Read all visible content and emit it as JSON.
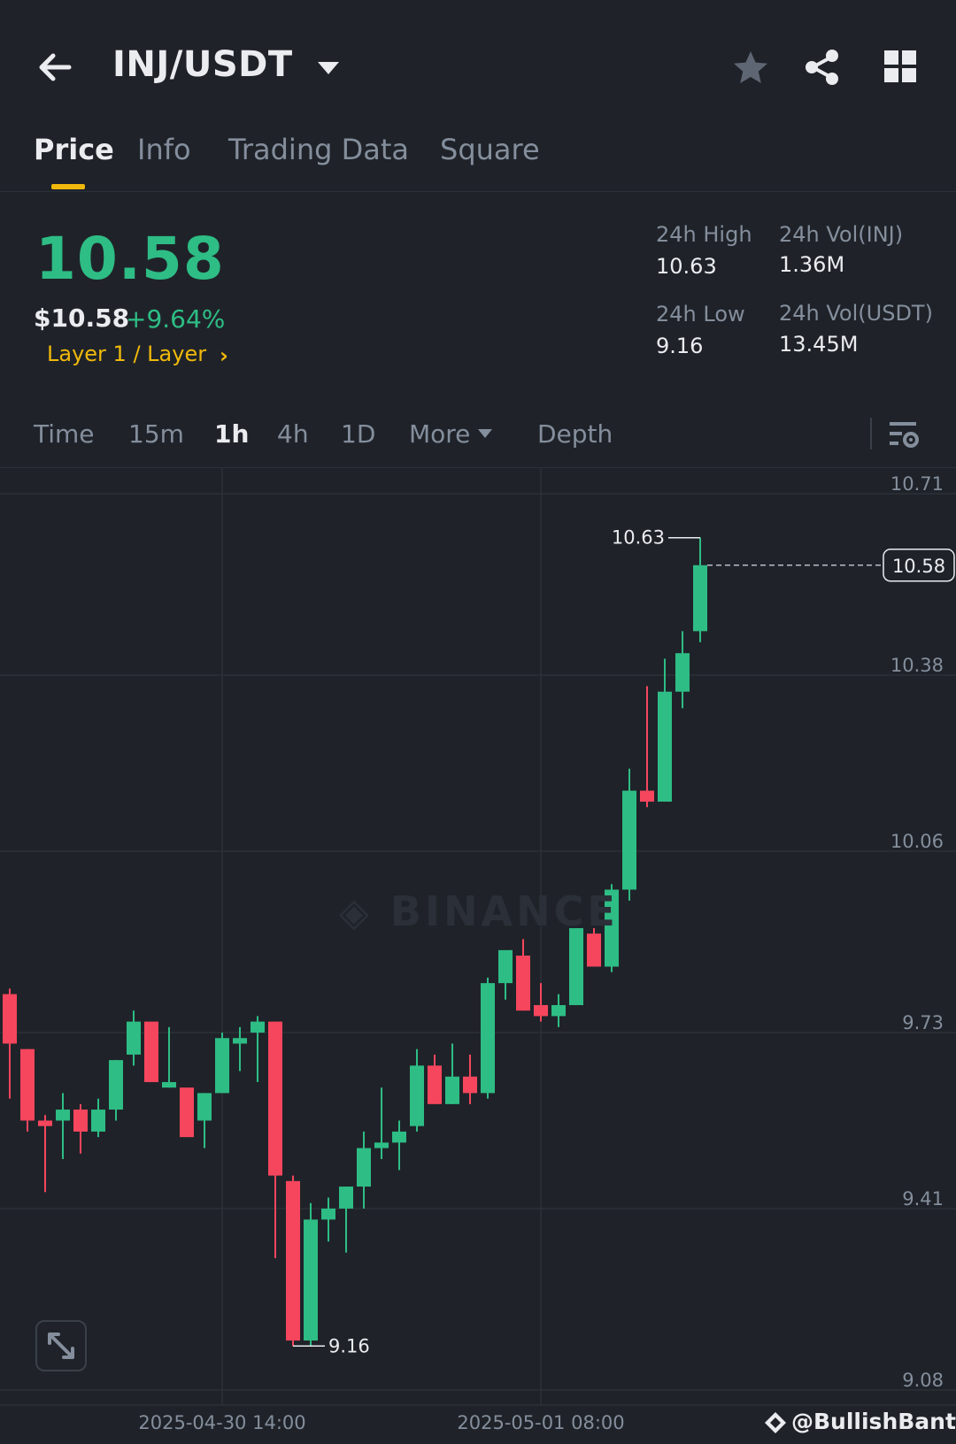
{
  "header": {
    "pair": "INJ/USDT",
    "icons": [
      "back-arrow-icon",
      "caret-down-icon",
      "star-icon",
      "share-icon",
      "grid-icon"
    ]
  },
  "tabs": [
    {
      "label": "Price",
      "active": true
    },
    {
      "label": "Info",
      "active": false
    },
    {
      "label": "Trading Data",
      "active": false
    },
    {
      "label": "Square",
      "active": false
    }
  ],
  "ticker": {
    "last_price": "10.58",
    "usd_price": "$10.58",
    "change": "+9.64%",
    "tag": "Layer 1 / Layer",
    "tag_arrow": "›"
  },
  "stats": {
    "high_label": "24h High",
    "high_value": "10.63",
    "low_label": "24h Low",
    "low_value": "9.16",
    "vol_inj_label": "24h Vol(INJ)",
    "vol_inj_value": "1.36M",
    "vol_usdt_label": "24h Vol(USDT)",
    "vol_usdt_value": "13.45M"
  },
  "intervals": [
    {
      "label": "Time",
      "active": false
    },
    {
      "label": "15m",
      "active": false
    },
    {
      "label": "1h",
      "active": true
    },
    {
      "label": "4h",
      "active": false
    },
    {
      "label": "1D",
      "active": false
    },
    {
      "label": "More",
      "active": false,
      "dropdown": true
    },
    {
      "label": "Depth",
      "active": false
    }
  ],
  "colors": {
    "up": "#2ebd85",
    "down": "#f6465d",
    "accent": "#f0b90b",
    "background": "#1f2329",
    "grid": "#2b3139"
  },
  "watermark": "BINANCE",
  "handle": "@BullishBanter",
  "chart_data": {
    "type": "candlestick",
    "interval": "1h",
    "y_ticks": [
      "10.71",
      "10.38",
      "10.06",
      "9.73",
      "9.41",
      "9.08"
    ],
    "ylim": [
      9.08,
      10.71
    ],
    "x_ticks": [
      "2025-04-30 14:00",
      "2025-05-01 08:00"
    ],
    "x_tick_index": [
      12,
      30
    ],
    "last_price_label": "10.58",
    "high_annotation": "10.63",
    "low_annotation": "9.16",
    "candles": [
      {
        "o": 9.8,
        "h": 9.81,
        "l": 9.61,
        "c": 9.71
      },
      {
        "o": 9.7,
        "h": 9.7,
        "l": 9.55,
        "c": 9.57
      },
      {
        "o": 9.57,
        "h": 9.58,
        "l": 9.44,
        "c": 9.56
      },
      {
        "o": 9.57,
        "h": 9.62,
        "l": 9.5,
        "c": 9.59
      },
      {
        "o": 9.59,
        "h": 9.6,
        "l": 9.51,
        "c": 9.55
      },
      {
        "o": 9.55,
        "h": 9.61,
        "l": 9.54,
        "c": 9.59
      },
      {
        "o": 9.59,
        "h": 9.68,
        "l": 9.57,
        "c": 9.68
      },
      {
        "o": 9.69,
        "h": 9.77,
        "l": 9.67,
        "c": 9.75
      },
      {
        "o": 9.75,
        "h": 9.75,
        "l": 9.64,
        "c": 9.64
      },
      {
        "o": 9.63,
        "h": 9.74,
        "l": 9.63,
        "c": 9.64
      },
      {
        "o": 9.63,
        "h": 9.63,
        "l": 9.54,
        "c": 9.54
      },
      {
        "o": 9.57,
        "h": 9.62,
        "l": 9.52,
        "c": 9.62
      },
      {
        "o": 9.62,
        "h": 9.73,
        "l": 9.62,
        "c": 9.72
      },
      {
        "o": 9.71,
        "h": 9.74,
        "l": 9.66,
        "c": 9.72
      },
      {
        "o": 9.73,
        "h": 9.76,
        "l": 9.64,
        "c": 9.75
      },
      {
        "o": 9.75,
        "h": 9.75,
        "l": 9.32,
        "c": 9.47
      },
      {
        "o": 9.46,
        "h": 9.47,
        "l": 9.16,
        "c": 9.17
      },
      {
        "o": 9.17,
        "h": 9.42,
        "l": 9.16,
        "c": 9.39
      },
      {
        "o": 9.39,
        "h": 9.43,
        "l": 9.35,
        "c": 9.41
      },
      {
        "o": 9.41,
        "h": 9.45,
        "l": 9.33,
        "c": 9.45
      },
      {
        "o": 9.45,
        "h": 9.55,
        "l": 9.41,
        "c": 9.52
      },
      {
        "o": 9.52,
        "h": 9.63,
        "l": 9.5,
        "c": 9.53
      },
      {
        "o": 9.53,
        "h": 9.57,
        "l": 9.48,
        "c": 9.55
      },
      {
        "o": 9.56,
        "h": 9.7,
        "l": 9.55,
        "c": 9.67
      },
      {
        "o": 9.67,
        "h": 9.69,
        "l": 9.6,
        "c": 9.6
      },
      {
        "o": 9.6,
        "h": 9.71,
        "l": 9.6,
        "c": 9.65
      },
      {
        "o": 9.65,
        "h": 9.69,
        "l": 9.6,
        "c": 9.62
      },
      {
        "o": 9.62,
        "h": 9.83,
        "l": 9.61,
        "c": 9.82
      },
      {
        "o": 9.82,
        "h": 9.86,
        "l": 9.79,
        "c": 9.88
      },
      {
        "o": 9.87,
        "h": 9.9,
        "l": 9.77,
        "c": 9.77
      },
      {
        "o": 9.78,
        "h": 9.82,
        "l": 9.75,
        "c": 9.76
      },
      {
        "o": 9.76,
        "h": 9.8,
        "l": 9.74,
        "c": 9.78
      },
      {
        "o": 9.78,
        "h": 9.92,
        "l": 9.78,
        "c": 9.92
      },
      {
        "o": 9.91,
        "h": 9.92,
        "l": 9.85,
        "c": 9.85
      },
      {
        "o": 9.85,
        "h": 10.0,
        "l": 9.84,
        "c": 9.99
      },
      {
        "o": 9.99,
        "h": 10.21,
        "l": 9.97,
        "c": 10.17
      },
      {
        "o": 10.17,
        "h": 10.36,
        "l": 10.14,
        "c": 10.15
      },
      {
        "o": 10.15,
        "h": 10.41,
        "l": 10.15,
        "c": 10.35
      },
      {
        "o": 10.35,
        "h": 10.46,
        "l": 10.32,
        "c": 10.42
      },
      {
        "o": 10.46,
        "h": 10.63,
        "l": 10.44,
        "c": 10.58
      }
    ]
  }
}
